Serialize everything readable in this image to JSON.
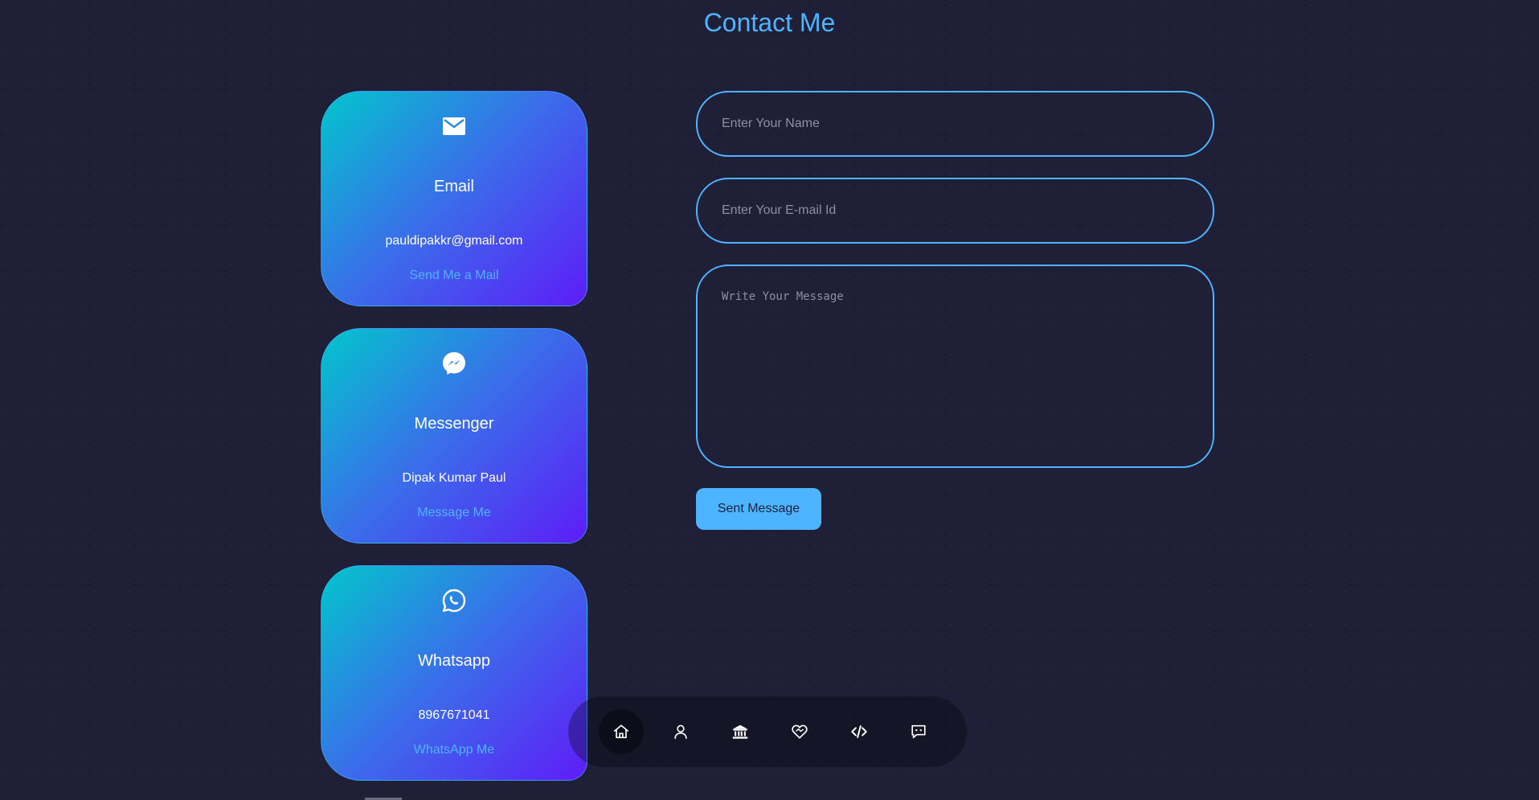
{
  "header": {
    "title": "Contact Me"
  },
  "contact_cards": [
    {
      "icon": "email-icon",
      "title": "Email",
      "value": "pauldipakkr@gmail.com",
      "link_label": "Send Me a Mail"
    },
    {
      "icon": "messenger-icon",
      "title": "Messenger",
      "value": "Dipak Kumar Paul",
      "link_label": "Message Me"
    },
    {
      "icon": "whatsapp-icon",
      "title": "Whatsapp",
      "value": "8967671041",
      "link_label": "WhatsApp Me"
    }
  ],
  "form": {
    "name_placeholder": "Enter Your Name",
    "email_placeholder": "Enter Your E-mail Id",
    "message_placeholder": "Write Your Message",
    "submit_label": "Sent Message"
  },
  "bottom_nav": {
    "items": [
      {
        "icon": "home-icon",
        "active": true
      },
      {
        "icon": "user-icon",
        "active": false
      },
      {
        "icon": "bank-icon",
        "active": false
      },
      {
        "icon": "heart-handshake-icon",
        "active": false
      },
      {
        "icon": "code-icon",
        "active": false
      },
      {
        "icon": "chat-icon",
        "active": false
      }
    ]
  },
  "colors": {
    "background": "#1f1f38",
    "accent": "#4db5ff",
    "card_gradient_start": "#02c6cc",
    "card_gradient_end": "#5e1cf8"
  }
}
